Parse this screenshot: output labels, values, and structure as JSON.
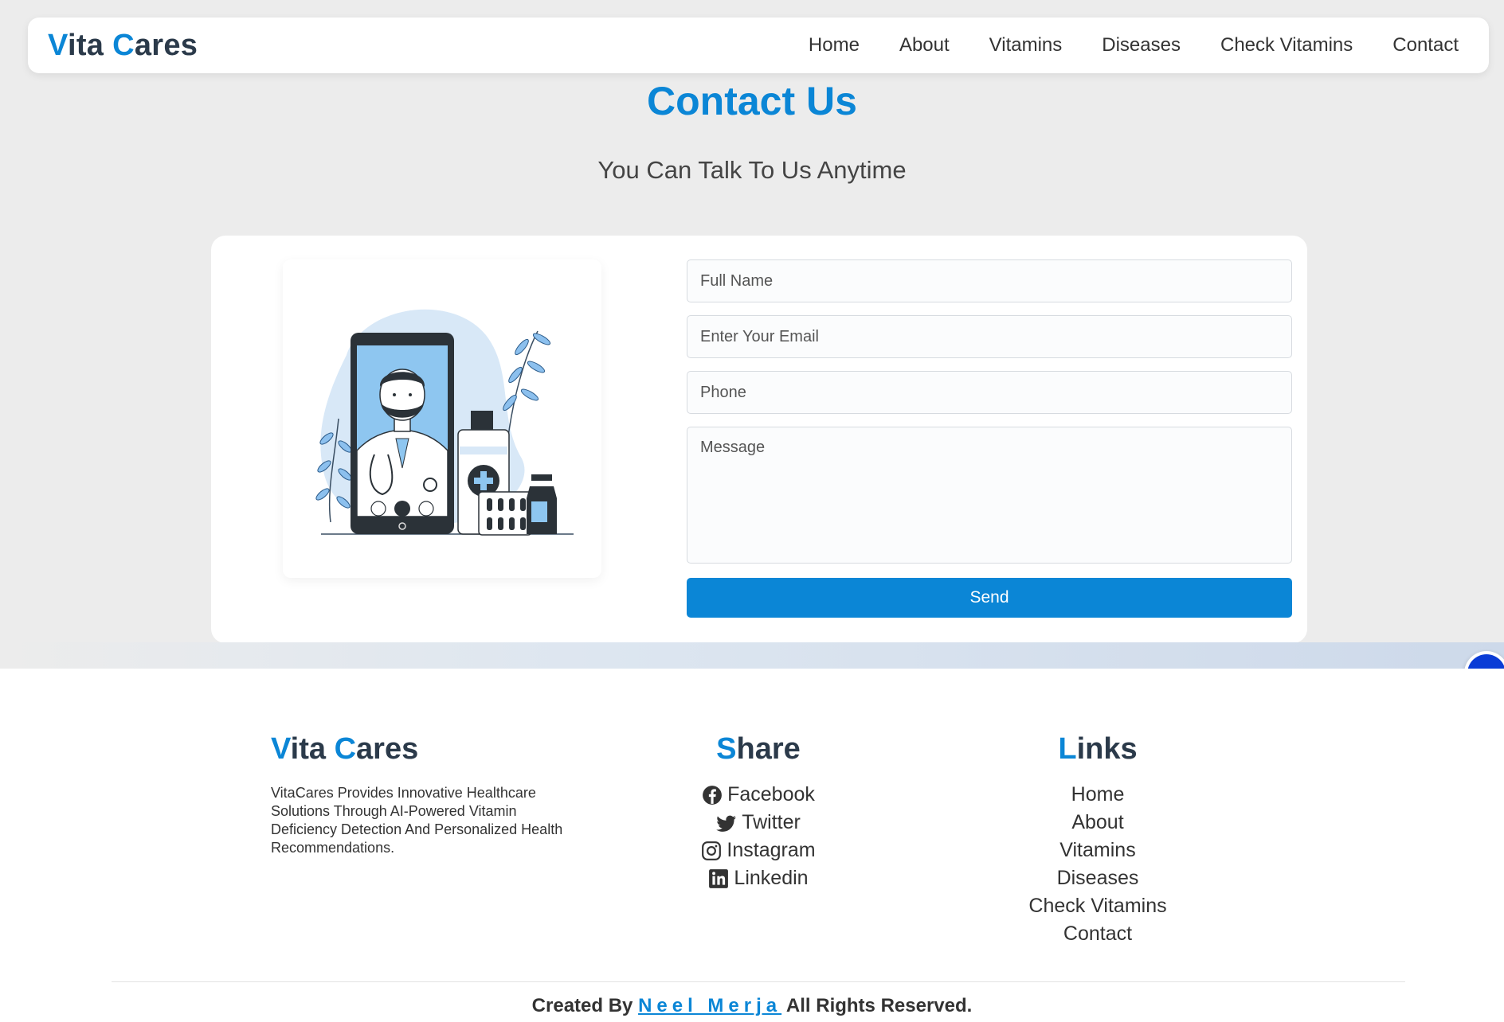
{
  "brand": {
    "first_letter": "V",
    "first_rest": "ita ",
    "second_letter": "C",
    "second_rest": "ares"
  },
  "nav": [
    {
      "label": "Home"
    },
    {
      "label": "About"
    },
    {
      "label": "Vitamins"
    },
    {
      "label": "Diseases"
    },
    {
      "label": "Check Vitamins"
    },
    {
      "label": "Contact"
    }
  ],
  "hero": {
    "title": "Contact Us",
    "subtitle": "You Can Talk To Us Anytime"
  },
  "form": {
    "name_placeholder": "Full Name",
    "email_placeholder": "Enter Your Email",
    "phone_placeholder": "Phone",
    "message_placeholder": "Message",
    "send_label": "Send"
  },
  "footer": {
    "brand_description": "VitaCares Provides Innovative Healthcare Solutions Through AI-Powered Vitamin Deficiency Detection And Personalized Health Recommendations.",
    "share_title_first": "S",
    "share_title_rest": "hare",
    "share": [
      {
        "label": "Facebook",
        "icon": "facebook-icon"
      },
      {
        "label": "Twitter",
        "icon": "twitter-icon"
      },
      {
        "label": "Instagram",
        "icon": "instagram-icon"
      },
      {
        "label": "Linkedin",
        "icon": "linkedin-icon"
      }
    ],
    "links_title_first": "L",
    "links_title_rest": "inks",
    "links": [
      {
        "label": "Home"
      },
      {
        "label": "About"
      },
      {
        "label": "Vitamins"
      },
      {
        "label": "Diseases"
      },
      {
        "label": "Check Vitamins"
      },
      {
        "label": "Contact"
      }
    ],
    "credits_prefix": "Created By ",
    "credits_author": "Neel Merja",
    "credits_suffix": " All Rights Reserved."
  },
  "colors": {
    "accent": "#0b86d6",
    "heading": "#2b3a4a",
    "background": "#ececec"
  }
}
